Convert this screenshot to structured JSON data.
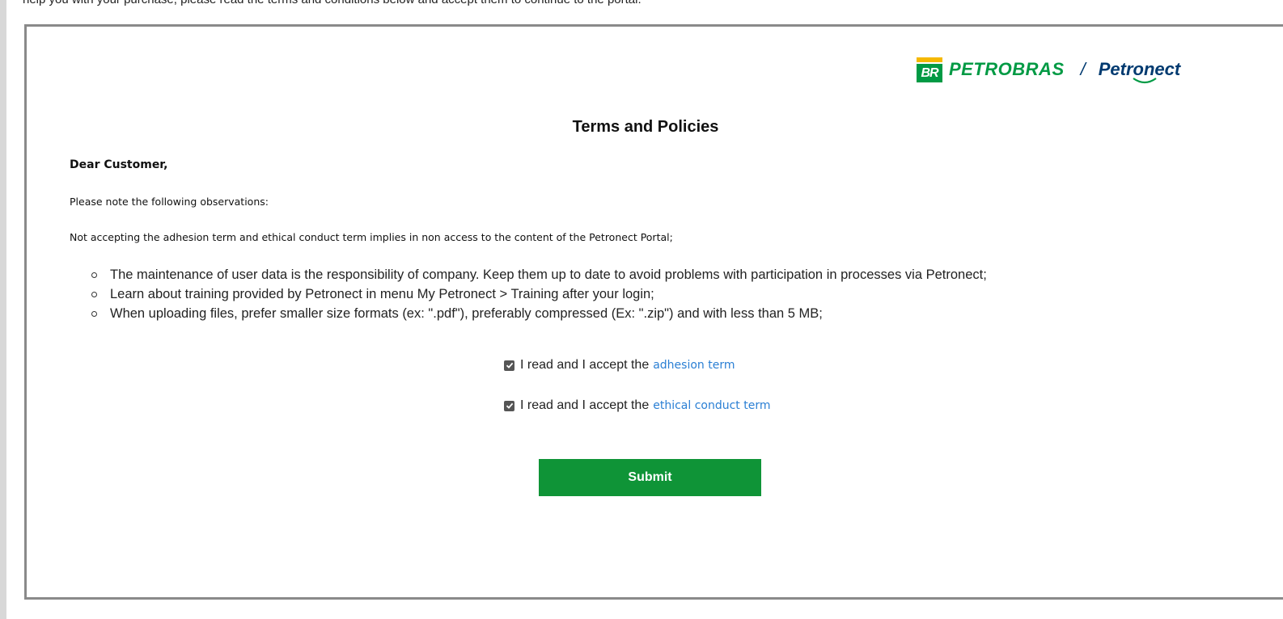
{
  "top_strip_text": "help you with your purchase, please read the terms and conditions below and accept them to continue to the portal.",
  "logo": {
    "badge_text": "BR",
    "petrobras": "PETROBRAS",
    "separator": "/",
    "petronect": "Petronect"
  },
  "title": "Terms and Policies",
  "greeting": "Dear Customer,",
  "intro": "Please note the following observations:",
  "warning": "Not accepting the adhesion term and ethical conduct term implies in non access to the content of the Petronect Portal;",
  "bullets": [
    "The maintenance of user data is the responsibility of company. Keep them up to date to avoid problems with participation in processes via Petronect;",
    "Learn about training provided by Petronect in menu My Petronect > Training after your login;",
    "When uploading files, prefer smaller size formats (ex: \".pdf\"), preferably compressed (Ex: \".zip\") and with less than 5 MB;"
  ],
  "checkboxes": [
    {
      "prefix": "I read and I accept the",
      "link": "adhesion term",
      "checked": true
    },
    {
      "prefix": "I read and I accept the",
      "link": "ethical conduct term",
      "checked": true
    }
  ],
  "submit_label": "Submit",
  "colors": {
    "petrobras_green": "#009a44",
    "petrobras_yellow": "#f5b800",
    "petronect_blue": "#003a70",
    "button_green": "#0f9437",
    "link_blue": "#2a7fd4"
  }
}
